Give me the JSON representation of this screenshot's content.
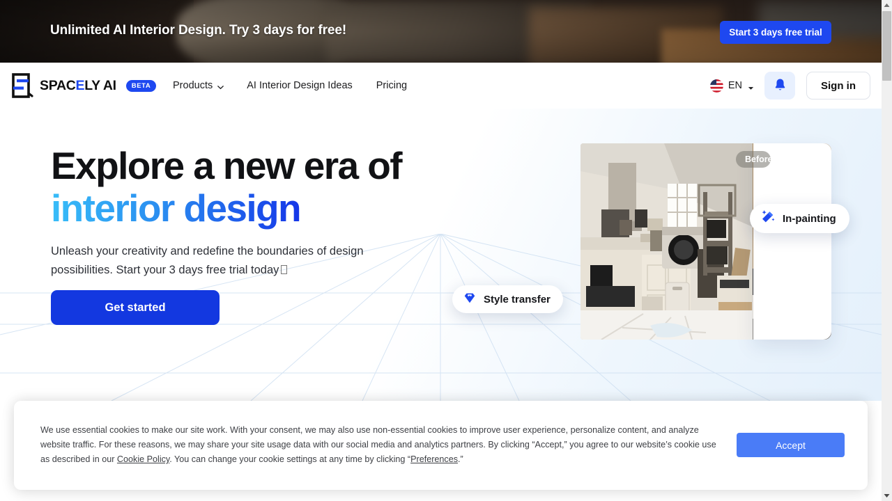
{
  "promo": {
    "message": "Unlimited AI Interior Design. Try 3 days for free!",
    "cta_label": "Start 3 days free trial",
    "cta_color": "#1e48f0"
  },
  "header": {
    "logo_text_before": "SPAC",
    "logo_text_accent": "E",
    "logo_text_after": "LY AI",
    "badge": "BETA",
    "nav": [
      {
        "label": "Products",
        "has_caret": true
      },
      {
        "label": "AI Interior Design Ideas",
        "has_caret": false
      },
      {
        "label": "Pricing",
        "has_caret": false
      }
    ],
    "language": "EN",
    "flag_icon": "us-flag-icon",
    "bell_icon": "bell-icon",
    "signin_label": "Sign in"
  },
  "hero": {
    "heading_line1": "Explore a new era of",
    "heading_line2": "interior design",
    "paragraph_line1": "Unleash your creativity and redefine the boundaries of design",
    "paragraph_line2": "possibilities. Start your 3 days free trial today",
    "cta_label": "Get started",
    "cta_color": "#1338e0",
    "heading_gradient_from": "#38bdf8",
    "heading_gradient_to": "#1536e8",
    "before_pill": "Before",
    "chips": [
      {
        "label": "Style transfer",
        "icon": "diamond-icon"
      },
      {
        "label": "In-painting",
        "icon": "magic-wand-icon"
      }
    ]
  },
  "cookie": {
    "text_1": "We use essential cookies to make our site work. With your consent, we may also use non-essential cookies to improve user experience, personalize content, and analyze website traffic. For these reasons, we may share your site usage data with our social media and analytics partners. By clicking “Accept,” you agree to our website’s cookie use as described in our ",
    "link_policy": "Cookie Policy",
    "text_2": ". You can change your cookie settings at any time by clicking “",
    "link_preferences": "Preferences",
    "text_3": ".”",
    "accept_label": "Accept",
    "accept_color": "#4a7cf7"
  }
}
